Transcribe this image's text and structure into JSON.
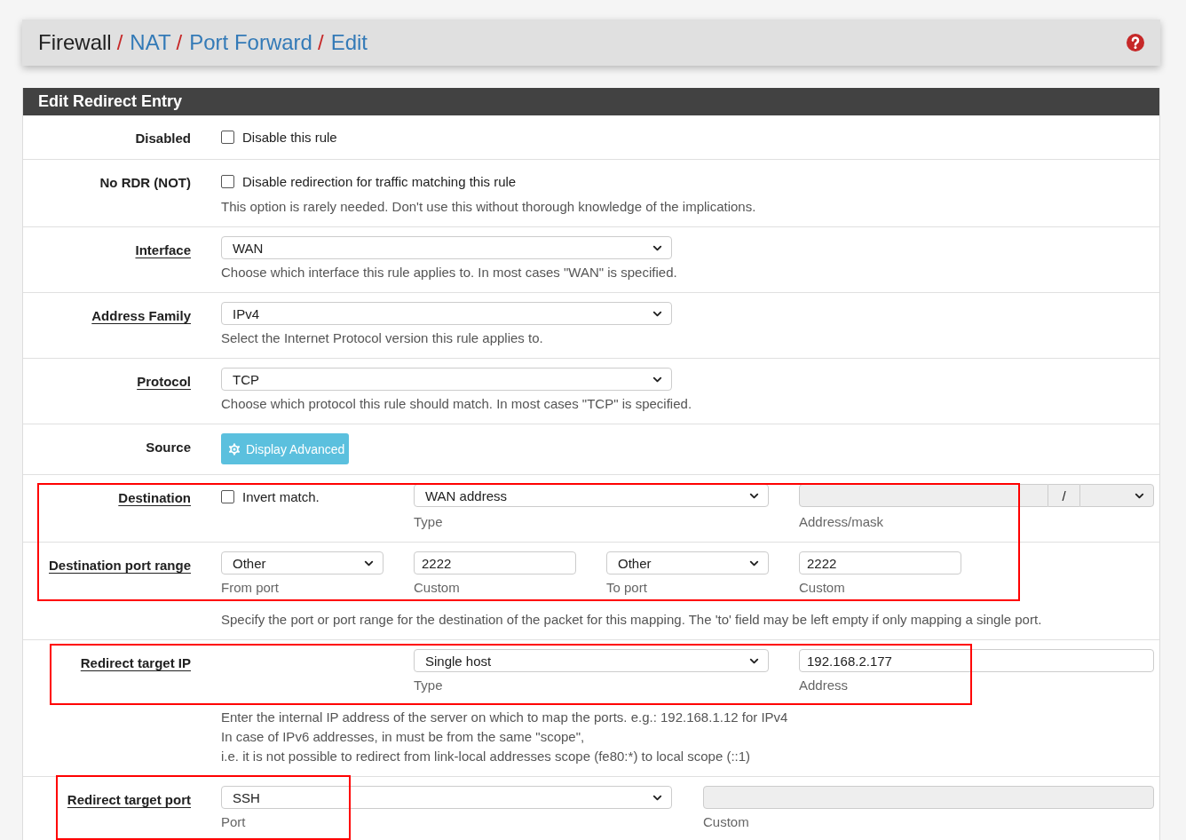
{
  "breadcrumb": [
    {
      "label": "Firewall",
      "link": false,
      "separator": "/"
    },
    {
      "label": "NAT",
      "link": true,
      "separator": "/"
    },
    {
      "label": "Port Forward",
      "link": true,
      "separator": "/"
    },
    {
      "label": "Edit",
      "link": true
    }
  ],
  "panel": {
    "title": "Edit Redirect Entry"
  },
  "sections": [
    {
      "highlighted": false,
      "rows": [
        {
          "kind": "checkbox",
          "label": "Disabled",
          "linked": false,
          "checked": false,
          "text": "Disable this rule",
          "help": []
        },
        {
          "kind": "checkbox",
          "label": "No RDR (NOT)",
          "linked": false,
          "checked": false,
          "text": "Disable redirection for traffic matching this rule",
          "help": [
            "This option is rarely needed. Don't use this without thorough knowledge of the implications."
          ]
        },
        {
          "kind": "select",
          "label": "Interface",
          "linked": true,
          "value": "WAN",
          "help": [
            "Choose which interface this rule applies to. In most cases \"WAN\" is specified."
          ]
        },
        {
          "kind": "select",
          "label": "Address Family",
          "linked": true,
          "value": "IPv4",
          "help": [
            "Select the Internet Protocol version this rule applies to."
          ]
        },
        {
          "kind": "select",
          "label": "Protocol",
          "linked": true,
          "value": "TCP",
          "help": [
            "Choose which protocol this rule should match. In most cases \"TCP\" is specified."
          ]
        },
        {
          "kind": "button",
          "label": "Source",
          "linked": false,
          "button": "Display Advanced",
          "help": []
        }
      ]
    },
    {
      "highlighted": true,
      "rows": [
        {
          "kind": "destination",
          "label": "Destination",
          "linked": true,
          "checked": false,
          "text": "Invert match.",
          "type": "WAN address",
          "type_caption": "Type",
          "address_disabled": true,
          "mask_separator": "/",
          "address_caption": "Address/mask",
          "help": []
        },
        {
          "kind": "ports",
          "label": "Destination port range",
          "linked": true,
          "from": "Other",
          "from_caption": "From port",
          "from_custom": "2222",
          "from_custom_caption": "Custom",
          "to": "Other",
          "to_caption": "To port",
          "to_custom": "2222",
          "to_custom_caption": "Custom",
          "help": [
            "Specify the port or port range for the destination of the packet for this mapping. The 'to' field may be left empty if only mapping a single port."
          ]
        }
      ]
    },
    {
      "highlighted": true,
      "rows": [
        {
          "kind": "target_ip",
          "label": "Redirect target IP",
          "linked": true,
          "type": "Single host",
          "type_caption": "Type",
          "address": "192.168.2.177",
          "address_caption": "Address",
          "help": [
            "Enter the internal IP address of the server on which to map the ports. e.g.: 192.168.1.12 for IPv4",
            "In case of IPv6 addresses, in must be from the same \"scope\",",
            "i.e. it is not possible to redirect from link-local addresses scope (fe80:*) to local scope (::1)"
          ]
        }
      ]
    },
    {
      "highlighted": true,
      "rows": [
        {
          "kind": "target_port",
          "label": "Redirect target port",
          "linked": true,
          "port": "SSH",
          "port_caption": "Port",
          "custom_disabled": true,
          "custom_caption": "Custom",
          "help": []
        }
      ]
    }
  ]
}
